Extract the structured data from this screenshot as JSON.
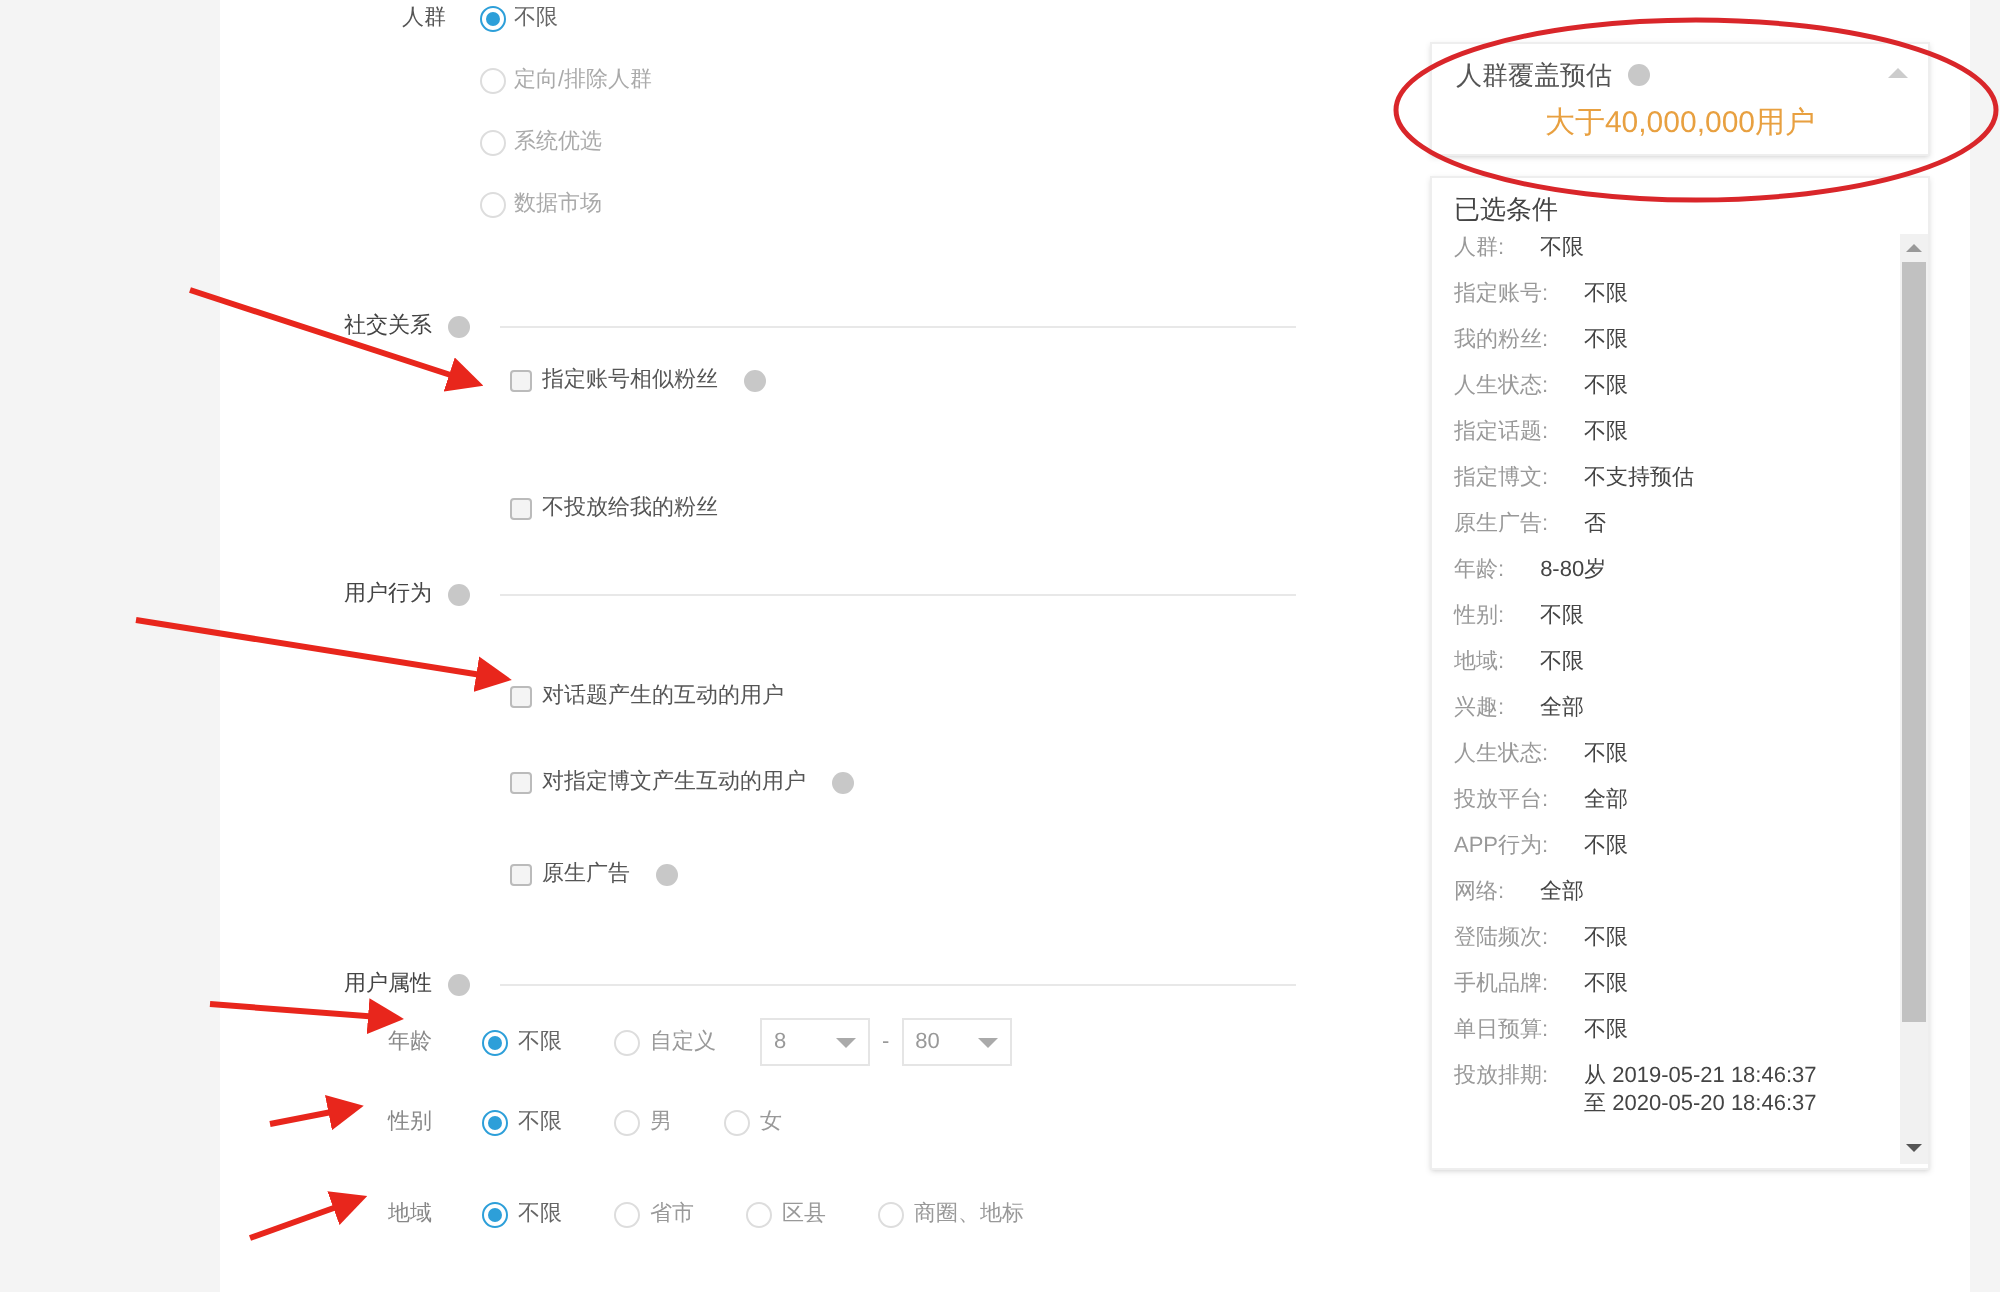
{
  "audience": {
    "label": "人群",
    "options": [
      {
        "label": "不限",
        "selected": true
      },
      {
        "label": "定向/排除人群",
        "selected": false
      },
      {
        "label": "系统优选",
        "selected": false
      },
      {
        "label": "数据市场",
        "selected": false
      }
    ]
  },
  "sections": [
    {
      "title": "社交关系",
      "items": [
        {
          "label": "指定账号相似粉丝",
          "checked": false,
          "info": true
        },
        {
          "label": "不投放给我的粉丝",
          "checked": false,
          "info": false
        }
      ]
    },
    {
      "title": "用户行为",
      "items": [
        {
          "label": "对话题产生的互动的用户",
          "checked": false,
          "info": false
        },
        {
          "label": "对指定博文产生互动的用户",
          "checked": false,
          "info": true
        },
        {
          "label": "原生广告",
          "checked": false,
          "info": true
        }
      ]
    }
  ],
  "attributes": {
    "title": "用户属性",
    "rows": [
      {
        "label": "年龄",
        "options": [
          {
            "label": "不限",
            "selected": true
          },
          {
            "label": "自定义",
            "selected": false
          }
        ],
        "range": {
          "from": "8",
          "separator": "-",
          "to": "80"
        }
      },
      {
        "label": "性别",
        "options": [
          {
            "label": "不限",
            "selected": true
          },
          {
            "label": "男",
            "selected": false
          },
          {
            "label": "女",
            "selected": false
          }
        ]
      },
      {
        "label": "地域",
        "options": [
          {
            "label": "不限",
            "selected": true
          },
          {
            "label": "省市",
            "selected": false
          },
          {
            "label": "区县",
            "selected": false
          },
          {
            "label": "商圈、地标",
            "selected": false
          }
        ]
      }
    ]
  },
  "estimate": {
    "title": "人群覆盖预估",
    "value": "大于40,000,000用户"
  },
  "selected_conditions": {
    "title": "已选条件",
    "rows": [
      {
        "label": "人群:",
        "value": [
          "不限"
        ]
      },
      {
        "label": "指定账号:",
        "value": [
          "不限"
        ]
      },
      {
        "label": "我的粉丝:",
        "value": [
          "不限"
        ]
      },
      {
        "label": "人生状态:",
        "value": [
          "不限"
        ]
      },
      {
        "label": "指定话题:",
        "value": [
          "不限"
        ]
      },
      {
        "label": "指定博文:",
        "value": [
          "不支持预估"
        ]
      },
      {
        "label": "原生广告:",
        "value": [
          "否"
        ]
      },
      {
        "label": "年龄:",
        "value": [
          "8-80岁"
        ]
      },
      {
        "label": "性别:",
        "value": [
          "不限"
        ]
      },
      {
        "label": "地域:",
        "value": [
          "不限"
        ]
      },
      {
        "label": "兴趣:",
        "value": [
          "全部"
        ]
      },
      {
        "label": "人生状态:",
        "value": [
          "不限"
        ]
      },
      {
        "label": "投放平台:",
        "value": [
          "全部"
        ]
      },
      {
        "label": "APP行为:",
        "value": [
          "不限"
        ]
      },
      {
        "label": "网络:",
        "value": [
          "全部"
        ]
      },
      {
        "label": "登陆频次:",
        "value": [
          "不限"
        ]
      },
      {
        "label": "手机品牌:",
        "value": [
          "不限"
        ]
      },
      {
        "label": "单日预算:",
        "value": [
          "不限"
        ]
      },
      {
        "label": "投放排期:",
        "value": [
          "从 2019-05-21 18:46:37",
          "至 2020-05-20 18:46:37"
        ]
      }
    ]
  }
}
